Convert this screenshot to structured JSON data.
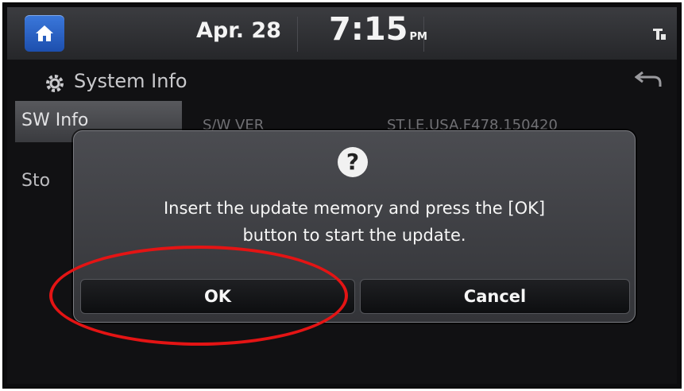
{
  "status_bar": {
    "date": "Apr. 28",
    "time": "7:15",
    "ampm": "PM",
    "home_icon": "home-icon",
    "signal_icon": "signal-icon"
  },
  "header": {
    "title": "System Info",
    "title_icon": "gear-icon",
    "back_icon": "back-arrow-icon"
  },
  "sidebar": {
    "items": [
      {
        "label": "SW Info",
        "selected": true
      },
      {
        "label": "Sto"
      }
    ]
  },
  "background_row": {
    "label": "S/W VER",
    "value": "ST.LE.USA.F478.150420"
  },
  "dialog": {
    "icon": "question-icon",
    "icon_glyph": "?",
    "message_line1": "Insert the update memory and press the [OK]",
    "message_line2": "button to start the update.",
    "ok_label": "OK",
    "cancel_label": "Cancel"
  },
  "colors": {
    "home_button": "#2f64c6",
    "highlight": "#e41414",
    "dialog_bg": "#404145"
  }
}
